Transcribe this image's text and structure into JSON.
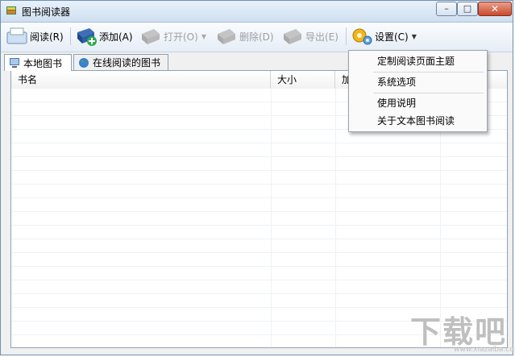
{
  "window": {
    "title": "图书阅读器"
  },
  "toolbar": {
    "read": "阅读(R)",
    "add": "添加(A)",
    "open": "打开(O)",
    "delete": "删除(D)",
    "export": "导出(E)",
    "settings": "设置(C)"
  },
  "tabs": [
    {
      "label": "本地图书",
      "active": true
    },
    {
      "label": "在线阅读的图书",
      "active": false
    }
  ],
  "table": {
    "columns": [
      "书名",
      "大小",
      "加"
    ]
  },
  "settings_menu": {
    "items": [
      "定制阅读页面主题",
      "系统选项",
      "使用说明",
      "关于文本图书阅读"
    ]
  },
  "watermark": {
    "text": "下载吧",
    "sub": "www.xiazaiba.com"
  },
  "colors": {
    "accent": "#6d8fb3",
    "close": "#c84a2e"
  }
}
